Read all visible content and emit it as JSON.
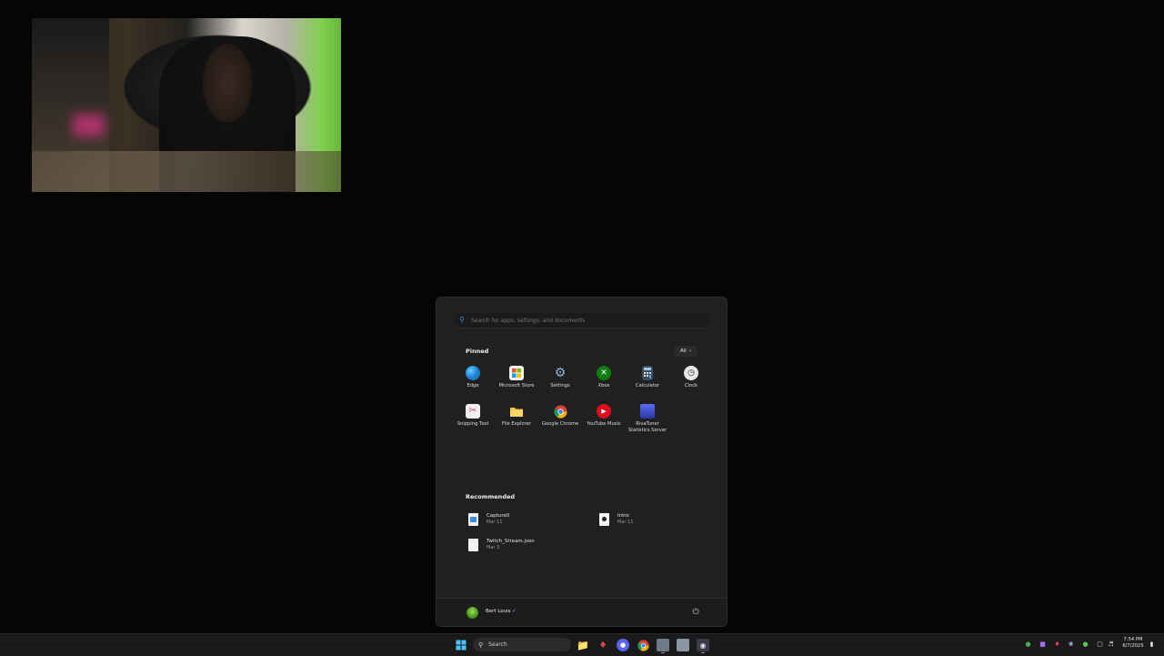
{
  "start_menu": {
    "search_placeholder": "Search for apps, settings, and documents",
    "pinned_title": "Pinned",
    "all_label": "All",
    "pinned": [
      {
        "label": "Edge",
        "icon": "edge-icon"
      },
      {
        "label": "Microsoft Store",
        "icon": "store-icon"
      },
      {
        "label": "Settings",
        "icon": "gear-icon"
      },
      {
        "label": "Xbox",
        "icon": "xbox-icon"
      },
      {
        "label": "Calculator",
        "icon": "calculator-icon"
      },
      {
        "label": "Clock",
        "icon": "clock-icon"
      },
      {
        "label": "Snipping Tool",
        "icon": "scissors-icon"
      },
      {
        "label": "File Explorer",
        "icon": "folder-icon"
      },
      {
        "label": "Google Chrome",
        "icon": "chrome-icon"
      },
      {
        "label": "YouTube Music",
        "icon": "youtube-music-icon"
      },
      {
        "label": "RivaTuner Statistics Server",
        "icon": "rivatuner-icon"
      }
    ],
    "recommended_title": "Recommended",
    "recommended": [
      {
        "name": "Capture0",
        "date": "Mar 11",
        "icon": "image-file-icon"
      },
      {
        "name": "Intro",
        "date": "Mar 11",
        "icon": "video-file-icon"
      },
      {
        "name": "Twitch_Stream.json",
        "date": "Mar 3",
        "icon": "document-icon"
      }
    ],
    "user_name": "Bert Louis"
  },
  "taskbar": {
    "search_label": "Search",
    "time": "7:54 PM",
    "date": "6/7/2025"
  },
  "colors": {
    "accent": "#3a8ee6",
    "menu_bg": "#202020",
    "taskbar_bg": "#1a1a1a"
  }
}
